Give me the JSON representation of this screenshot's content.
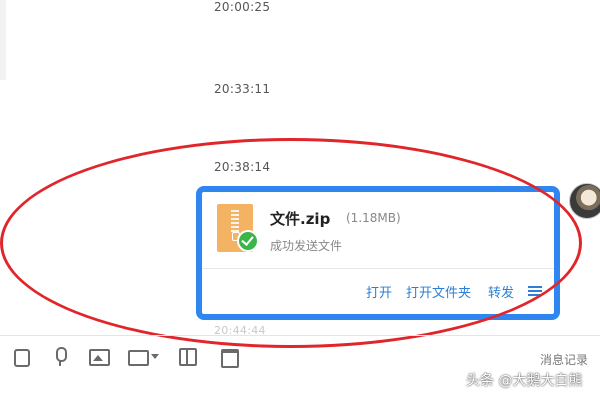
{
  "chat": {
    "timestamps": [
      "20:00:25",
      "20:33:11",
      "20:38:14",
      "20:44:44"
    ]
  },
  "file_message": {
    "file_name": "文件.zip",
    "file_size": "(1.18MB)",
    "status": "成功发送文件",
    "actions": {
      "open": "打开",
      "open_folder": "打开文件夹",
      "forward": "转发"
    },
    "icon": "zip-file-icon"
  },
  "toolbar": {
    "icons": [
      "emoji-icon",
      "microphone-icon",
      "image-icon",
      "folder-icon",
      "screenshot-icon",
      "calendar-icon"
    ],
    "history_label": "消息记录"
  },
  "watermark": {
    "text": "头条 @大鹅大白熊"
  },
  "colors": {
    "highlight_blue": "#2f86f0",
    "annotation_red": "#e0262b",
    "link_blue": "#2b7fd6",
    "success_green": "#3bb54a",
    "zip_orange": "#f4b263"
  }
}
